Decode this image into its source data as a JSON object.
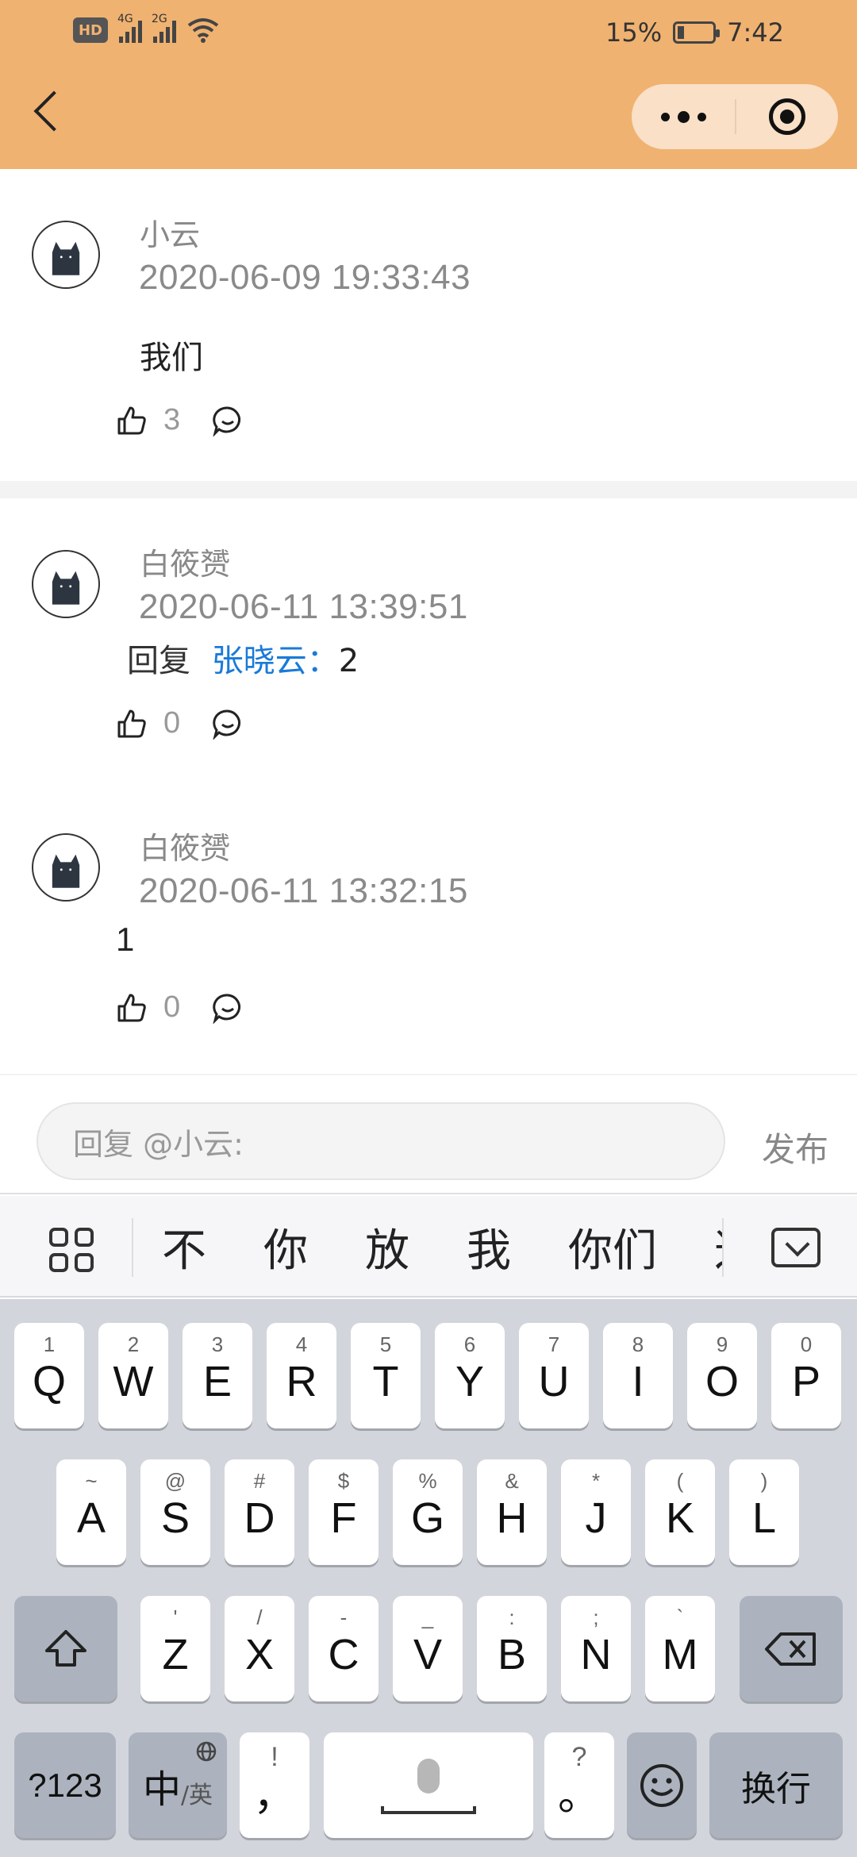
{
  "status": {
    "battery": "15%",
    "time": "7:42",
    "net1": "4G",
    "net2": "2G"
  },
  "comments": [
    {
      "name": "小云",
      "time": "2020-06-09 19:33:43",
      "text": "我们",
      "likes": "3"
    },
    {
      "name": "白筱赟",
      "time": "2020-06-11 13:39:51",
      "reply_prefix": "回复",
      "reply_to": "张晓云：",
      "text": "2",
      "likes": "0"
    },
    {
      "name": "白筱赟",
      "time": "2020-06-11 13:32:15",
      "text": "1",
      "likes": "0"
    }
  ],
  "reply_bar": {
    "placeholder": "回复 @小云:",
    "publish": "发布"
  },
  "candidates": [
    "不",
    "你",
    "放",
    "我",
    "你们",
    "这"
  ],
  "keyboard": {
    "row1": [
      {
        "key": "Q",
        "sub": "1"
      },
      {
        "key": "W",
        "sub": "2"
      },
      {
        "key": "E",
        "sub": "3"
      },
      {
        "key": "R",
        "sub": "4"
      },
      {
        "key": "T",
        "sub": "5"
      },
      {
        "key": "Y",
        "sub": "6"
      },
      {
        "key": "U",
        "sub": "7"
      },
      {
        "key": "I",
        "sub": "8"
      },
      {
        "key": "O",
        "sub": "9"
      },
      {
        "key": "P",
        "sub": "0"
      }
    ],
    "row2": [
      {
        "key": "A",
        "sub": "~"
      },
      {
        "key": "S",
        "sub": "@"
      },
      {
        "key": "D",
        "sub": "#"
      },
      {
        "key": "F",
        "sub": "$"
      },
      {
        "key": "G",
        "sub": "%"
      },
      {
        "key": "H",
        "sub": "&"
      },
      {
        "key": "J",
        "sub": "*"
      },
      {
        "key": "K",
        "sub": "("
      },
      {
        "key": "L",
        "sub": ")"
      }
    ],
    "row3": [
      {
        "key": "Z",
        "sub": "'"
      },
      {
        "key": "X",
        "sub": "/"
      },
      {
        "key": "C",
        "sub": "-"
      },
      {
        "key": "V",
        "sub": "_"
      },
      {
        "key": "B",
        "sub": ":"
      },
      {
        "key": "N",
        "sub": ";"
      },
      {
        "key": "M",
        "sub": "`"
      }
    ],
    "sym": "?123",
    "lang_main": "中",
    "lang_sub": "/英",
    "comma_main": "，",
    "comma_sub": "!",
    "period_main": "。",
    "period_sub": "?",
    "enter": "换行"
  },
  "colors": {
    "header": "#f0b271",
    "link": "#1a7ad8",
    "keyboard_bg": "#d2d5db"
  }
}
